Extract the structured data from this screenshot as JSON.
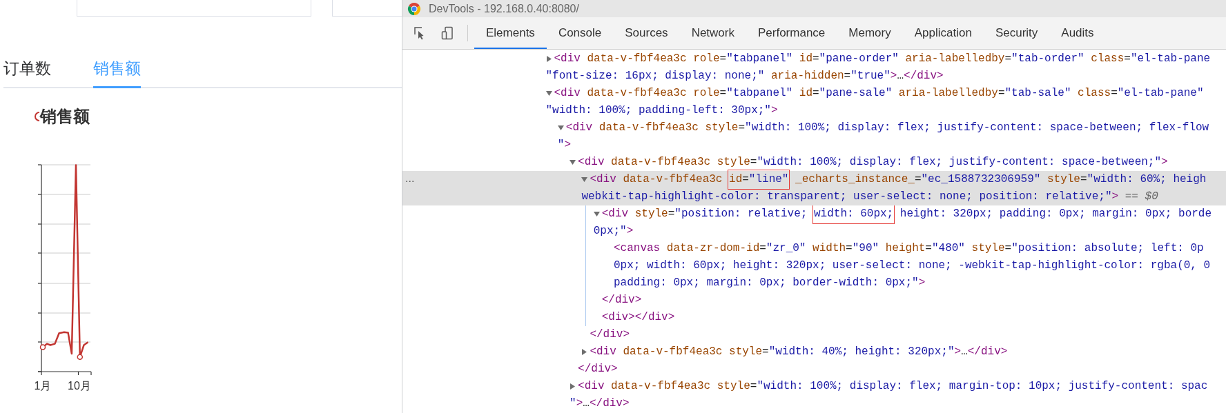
{
  "page": {
    "tabs": [
      {
        "label": "订单数",
        "selected": false
      },
      {
        "label": "销售额",
        "selected": true
      }
    ],
    "chart": {
      "title": "销售额",
      "x_labels": [
        "1月",
        "10月"
      ]
    }
  },
  "devtools": {
    "title": "DevTools - 192.168.0.40:8080/",
    "tabs": [
      {
        "label": "Elements",
        "selected": true
      },
      {
        "label": "Console",
        "selected": false
      },
      {
        "label": "Sources",
        "selected": false
      },
      {
        "label": "Network",
        "selected": false
      },
      {
        "label": "Performance",
        "selected": false
      },
      {
        "label": "Memory",
        "selected": false
      },
      {
        "label": "Application",
        "selected": false
      },
      {
        "label": "Security",
        "selected": false
      },
      {
        "label": "Audits",
        "selected": false
      }
    ],
    "nodes": [
      {
        "expanded": false,
        "selected": false,
        "lines": [
          "<div data-v-fbf4ea3c role=\"tabpanel\" id=\"pane-order\" aria-labelledby=\"tab-order\" class=\"el-tab-pane",
          "\"font-size: 16px; display: none;\" aria-hidden=\"true\">…</div>"
        ]
      },
      {
        "expanded": true,
        "selected": false,
        "lines": [
          "<div data-v-fbf4ea3c role=\"tabpanel\" id=\"pane-sale\" aria-labelledby=\"tab-sale\" class=\"el-tab-pane\"",
          "\"width: 100%; padding-left: 30px;\">"
        ],
        "children": [
          {
            "expanded": true,
            "selected": false,
            "lines": [
              "<div data-v-fbf4ea3c style=\"width: 100%; display: flex; justify-content: space-between; flex-flow",
              "\">"
            ],
            "children": [
              {
                "expanded": true,
                "selected": false,
                "lines": [
                  "<div data-v-fbf4ea3c style=\"width: 100%; display: flex; justify-content: space-between;\">"
                ],
                "close": "</div>",
                "children": [
                  {
                    "expanded": true,
                    "selected": true,
                    "gutter": "...",
                    "console_ref": "== *$0*",
                    "close": "</div>",
                    "lines": [
                      [
                        {
                          "text": "<div data-v-fbf4ea3c ",
                          "boxed": false
                        },
                        {
                          "text": "id=\"line\"",
                          "boxed": true
                        },
                        {
                          "text": " _echarts_instance_=\"ec_1588732306959\" style=\"width: 60%; heigh",
                          "boxed": false
                        }
                      ],
                      "webkit-tap-highlight-color: transparent; user-select: none; position: relative;\">"
                    ],
                    "children": [
                      {
                        "expanded": true,
                        "selected": false,
                        "close": "</div>",
                        "lines": [
                          [
                            {
                              "text": "<div style=\"position: relative; ",
                              "boxed": false
                            },
                            {
                              "text": "width: 60px;",
                              "boxed": true
                            },
                            {
                              "text": " height: 320px; padding: 0px; margin: 0px; borde",
                              "boxed": false
                            }
                          ],
                          "0px;\">"
                        ],
                        "children": [
                          {
                            "selected": false,
                            "lines": [
                              "<canvas data-zr-dom-id=\"zr_0\" width=\"90\" height=\"480\" style=\"position: absolute; left: 0p",
                              "0px; width: 60px; height: 320px; user-select: none; -webkit-tap-highlight-color: rgba(0, 0",
                              "padding: 0px; margin: 0px; border-width: 0px;\">"
                            ]
                          }
                        ]
                      },
                      {
                        "selected": false,
                        "lines": [
                          "<div></div>"
                        ]
                      }
                    ]
                  },
                  {
                    "expanded": false,
                    "selected": false,
                    "lines": [
                      "<div data-v-fbf4ea3c style=\"width: 40%; height: 320px;\">…</div>"
                    ]
                  }
                ]
              },
              {
                "expanded": false,
                "selected": false,
                "lines": [
                  "<div data-v-fbf4ea3c style=\"width: 100%; display: flex; margin-top: 10px; justify-content: spac",
                  "\">…</div>"
                ]
              }
            ]
          }
        ]
      }
    ]
  }
}
